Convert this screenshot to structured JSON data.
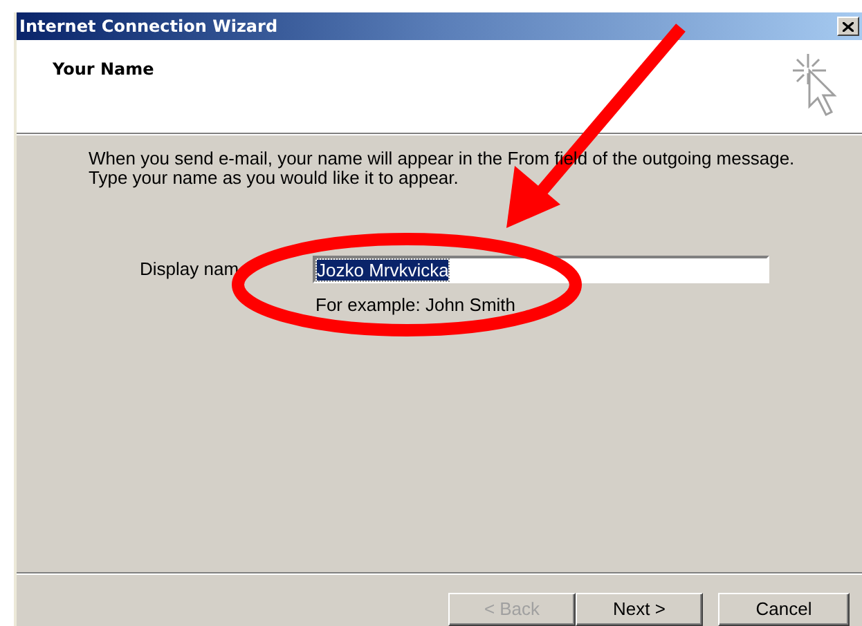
{
  "window": {
    "title": "Internet Connection Wizard"
  },
  "header": {
    "title": "Your Name"
  },
  "description": [
    "When you send e-mail, your name will appear in the From field of the outgoing message.",
    "Type your name as you would like it to appear."
  ],
  "display_name": {
    "label": "Display nam",
    "value": "Jozko Mrvkvicka",
    "selected": true,
    "hint": "For example: John Smith"
  },
  "buttons": [
    {
      "label": "< Back",
      "disabled": true
    },
    {
      "label": "Next >",
      "disabled": false
    },
    {
      "label": "Cancel",
      "disabled": false
    }
  ]
}
